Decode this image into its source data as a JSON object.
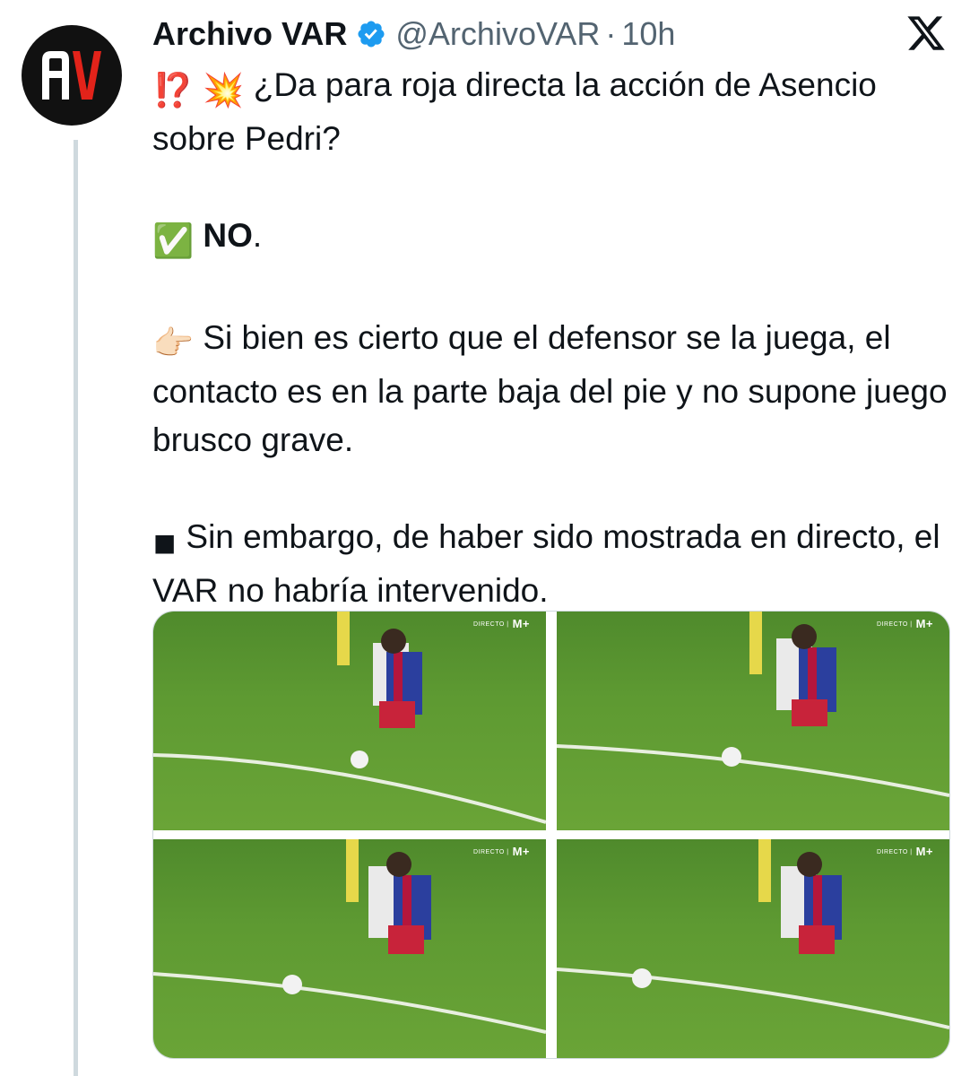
{
  "tweet": {
    "author": {
      "display_name": "Archivo VAR",
      "handle": "@ArchivoVAR",
      "separator": "·",
      "time": "10h",
      "avatar_initials": "AV",
      "verified_icon": "verified-badge-icon"
    },
    "platform_logo": "X",
    "lines": {
      "question_emoji_a": "⁉️",
      "question_emoji_b": "💥",
      "question": "¿Da para roja directa la acción de Asencio sobre Pedri?",
      "answer_emoji": "✅",
      "answer": "NO",
      "answer_punct": ".",
      "point_emoji": "👉🏻",
      "reason": "Si bien es cierto que el defensor se la juega, el contacto es en la parte baja del pie y no supone juego brusco grave.",
      "note_emoji": "◾",
      "note": "Sin embargo, de haber sido mostrada en directo, el VAR no habría intervenido."
    },
    "media": {
      "image_count": 4,
      "broadcast_label": "M+",
      "broadcast_small": "DIRECTO |"
    }
  },
  "colors": {
    "text": "#0f1419",
    "secondary": "#536471",
    "verified": "#1d9bf0",
    "thread_line": "#cfd9de",
    "pitch": "#5e9a32"
  }
}
